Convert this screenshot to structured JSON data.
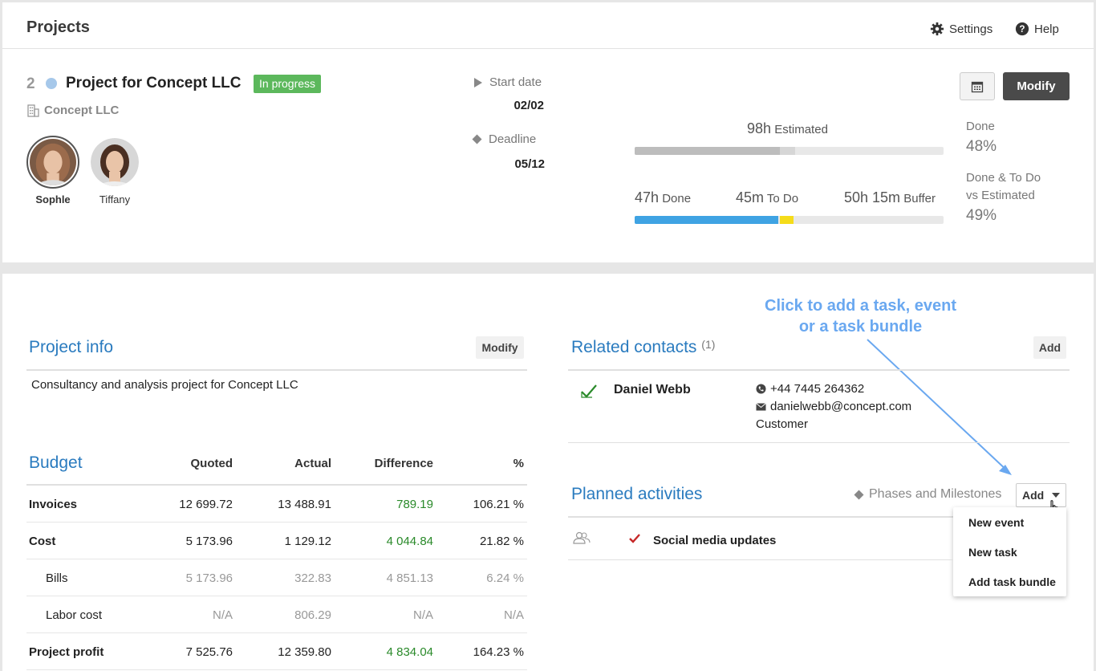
{
  "header": {
    "title": "Projects",
    "settings_label": "Settings",
    "help_label": "Help"
  },
  "project": {
    "number": "2",
    "name": "Project for Concept LLC",
    "status": "In progress",
    "company": "Concept LLC",
    "members": [
      {
        "name": "Sophle"
      },
      {
        "name": "Tiffany"
      }
    ],
    "start_date_label": "Start date",
    "start_date": "02/02",
    "deadline_label": "Deadline",
    "deadline": "05/12",
    "modify_label": "Modify"
  },
  "progress": {
    "estimated_value": "98h",
    "estimated_label": "Estimated",
    "done_value": "47h",
    "done_label": "Done",
    "todo_value": "45m",
    "todo_label": "To Do",
    "buffer_value": "50h 15m",
    "buffer_label": "Buffer",
    "done_pct_label": "Done",
    "done_pct": "48%",
    "done_todo_label_1": "Done & To Do",
    "done_todo_label_2": "vs Estimated",
    "done_todo_pct": "49%",
    "estimated_bar_fraction": 0.47,
    "done_bar_fraction": 0.465,
    "todo_bar_fraction": 0.045,
    "colors": {
      "done": "#3fa3e3",
      "todo": "#f5dc1a",
      "estimated": "#bdbdbd"
    }
  },
  "project_info": {
    "title": "Project info",
    "modify_label": "Modify",
    "description": "Consultancy and analysis project for Concept LLC"
  },
  "budget": {
    "title": "Budget",
    "columns": [
      "Quoted",
      "Actual",
      "Difference",
      "%"
    ],
    "rows": [
      {
        "label": "Invoices",
        "quoted": "12 699.72",
        "actual": "13 488.91",
        "difference": "789.19",
        "pct": "106.21 %"
      },
      {
        "label": "Cost",
        "quoted": "5 173.96",
        "actual": "1 129.12",
        "difference": "4 044.84",
        "pct": "21.82 %"
      },
      {
        "label": "Bills",
        "quoted": "5 173.96",
        "actual": "322.83",
        "difference": "4 851.13",
        "pct": "6.24 %"
      },
      {
        "label": "Labor cost",
        "quoted": "N/A",
        "actual": "806.29",
        "difference": "N/A",
        "pct": "N/A"
      },
      {
        "label": "Project profit",
        "quoted": "7 525.76",
        "actual": "12 359.80",
        "difference": "4 834.04",
        "pct": "164.23 %"
      }
    ]
  },
  "contacts": {
    "title": "Related contacts",
    "count": "(1)",
    "add_label": "Add",
    "items": [
      {
        "name": "Daniel Webb",
        "phone": "+44 7445 264362",
        "email": "danielwebb@concept.com",
        "role": "Customer"
      }
    ]
  },
  "activities": {
    "title": "Planned activities",
    "phases_label": "Phases and Milestones",
    "add_label": "Add",
    "menu": [
      "New event",
      "New task",
      "Add task bundle"
    ],
    "items": [
      {
        "name": "Social media updates"
      }
    ]
  },
  "callout": {
    "line1": "Click to add a task, event",
    "line2": "or a task bundle"
  }
}
